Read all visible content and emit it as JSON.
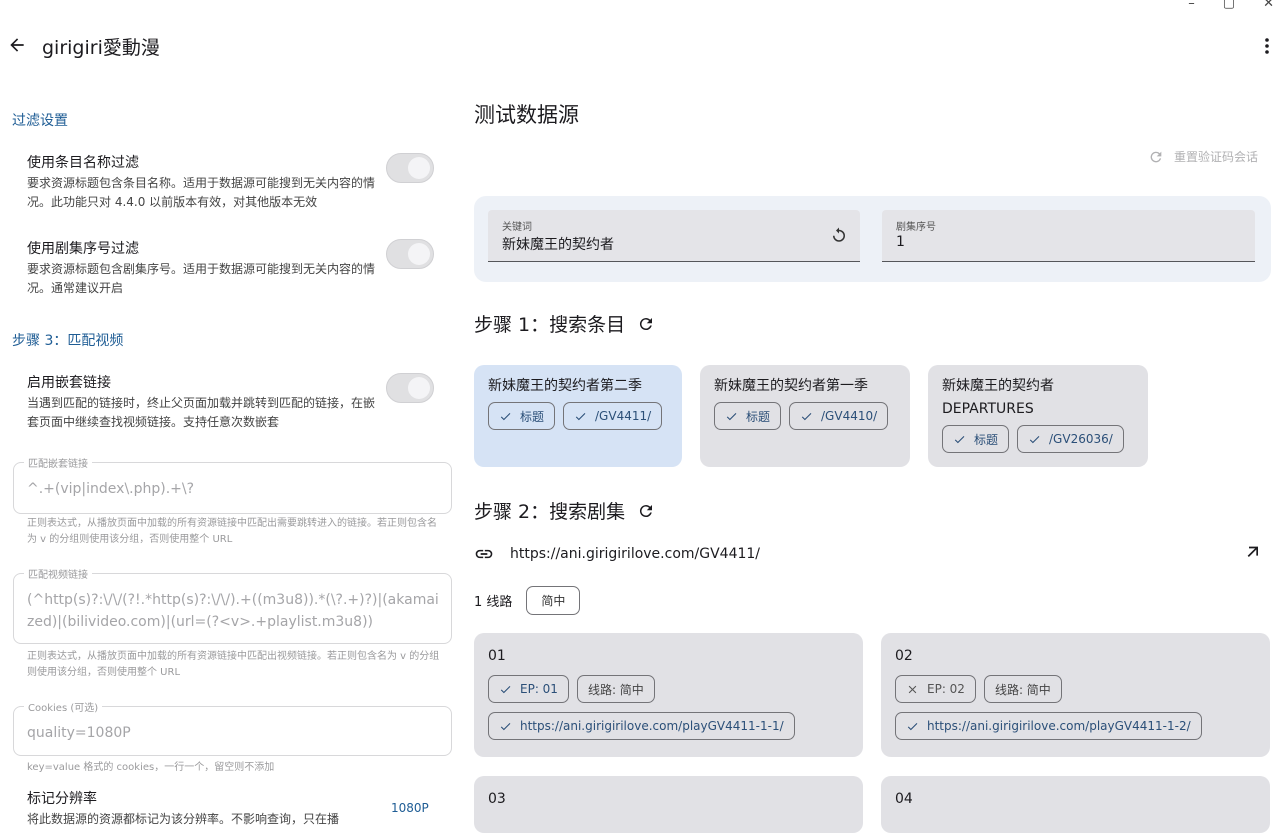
{
  "app": {
    "title": "girigiri愛動漫"
  },
  "window": {
    "minimize": "–",
    "maximize": "▢",
    "close": "✕"
  },
  "left": {
    "filter_section": "过滤设置",
    "settings": [
      {
        "title": "使用条目名称过滤",
        "desc": "要求资源标题包含条目名称。适用于数据源可能搜到无关内容的情况。此功能只对 4.4.0 以前版本有效，对其他版本无效",
        "enabled": true
      },
      {
        "title": "使用剧集序号过滤",
        "desc": "要求资源标题包含剧集序号。适用于数据源可能搜到无关内容的情况。通常建议开启",
        "enabled": true
      }
    ],
    "step3_section": "步骤 3：匹配视频",
    "nested": {
      "title": "启用嵌套链接",
      "desc": "当遇到匹配的链接时，终止父页面加载并跳转到匹配的链接，在嵌套页面中继续查找视频链接。支持任意次数嵌套",
      "enabled": true
    },
    "nested_field": {
      "label": "匹配嵌套链接",
      "value": "^.+(vip|index\\.php).+\\?",
      "helper": "正则表达式，从播放页面中加载的所有资源链接中匹配出需要跳转进入的链接。若正则包含名为 v 的分组则使用该分组，否则使用整个 URL"
    },
    "video_field": {
      "label": "匹配视频链接",
      "value": "(^http(s)?:\\/\\/(?!.*http(s)?:\\/\\/).+((m3u8)).*(\\?.+)?)|(akamaized)|(bilivideo.com)|(url=(?<v>.+playlist.m3u8))",
      "helper": "正则表达式，从播放页面中加载的所有资源链接中匹配出视频链接。若正则包含名为 v 的分组则使用该分组，否则使用整个 URL"
    },
    "cookies_field": {
      "label": "Cookies (可选)",
      "value": "quality=1080P",
      "helper": "key=value 格式的 cookies，一行一个，留空则不添加"
    },
    "resolution": {
      "title": "标记分辨率",
      "desc": "将此数据源的资源都标记为该分辨率。不影响查询，只在播",
      "value": "1080P"
    }
  },
  "right": {
    "heading": "测试数据源",
    "reset_button": "重置验证码会话",
    "keyword": {
      "label": "关键词",
      "value": "新妹魔王的契约者"
    },
    "episode": {
      "label": "剧集序号",
      "value": "1"
    },
    "step1": "步骤 1：搜索条目",
    "subjects": [
      {
        "name": "新妹魔王的契约者第二季",
        "title_chip": "标题",
        "path_chip": "/GV4411/",
        "selected": true
      },
      {
        "name": "新妹魔王的契约者第一季",
        "title_chip": "标题",
        "path_chip": "/GV4410/",
        "selected": false
      },
      {
        "name": "新妹魔王的契约者 DEPARTURES",
        "title_chip": "标题",
        "path_chip": "/GV26036/",
        "selected": false
      }
    ],
    "step2": "步骤 2：搜索剧集",
    "subject_url": "https://ani.girigirilove.com/GV4411/",
    "routes_label": "1 线路",
    "route_chip": "简中",
    "episodes": [
      {
        "name": "01",
        "ep_chip": "EP: 01",
        "ep_ok": true,
        "line_chip": "线路: 简中",
        "url": "https://ani.girigirilove.com/playGV4411-1-1/"
      },
      {
        "name": "02",
        "ep_chip": "EP: 02",
        "ep_ok": false,
        "line_chip": "线路: 简中",
        "url": "https://ani.girigirilove.com/playGV4411-1-2/"
      },
      {
        "name": "03"
      },
      {
        "name": "04"
      }
    ]
  }
}
